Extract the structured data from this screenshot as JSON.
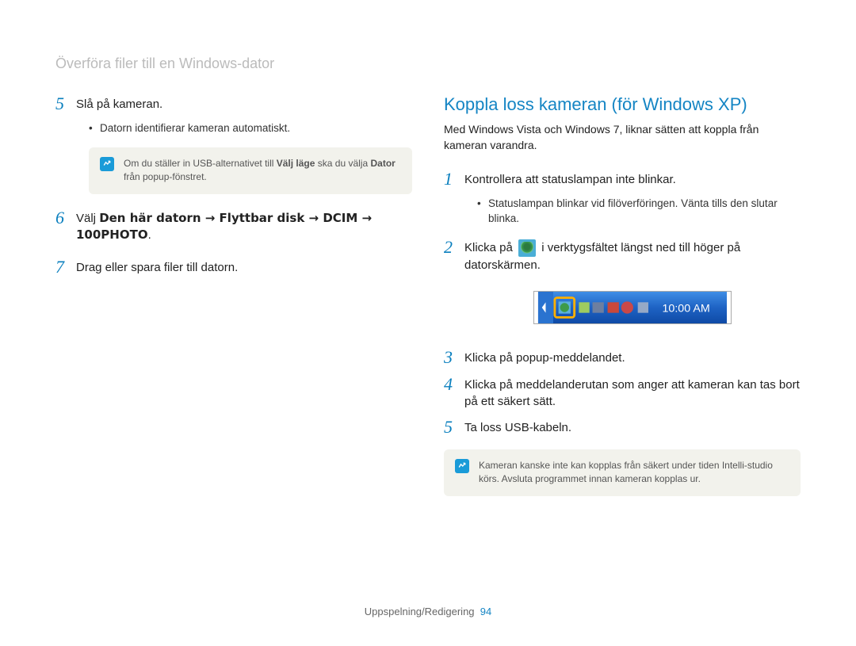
{
  "page_title": "Överföra ﬁler till en Windows-dator",
  "left": {
    "step5": {
      "num": "5",
      "text": "Slå på kameran.",
      "sub": "Datorn identiﬁerar kameran automatiskt."
    },
    "note1_prefix": "Om du ställer in USB-alternativet till ",
    "note1_bold1": "Välj läge",
    "note1_mid": " ska du välja ",
    "note1_bold2": "Dator",
    "note1_suffix": " från popup-fönstret.",
    "step6": {
      "num": "6",
      "prefix": "Välj ",
      "bold": "Den här datorn → Flyttbar disk → DCIM → 100PHOTO",
      "suffix": "."
    },
    "step7": {
      "num": "7",
      "text": "Drag eller spara ﬁler till datorn."
    }
  },
  "right": {
    "heading": "Koppla loss kameran (för Windows XP)",
    "intro": "Med Windows Vista och Windows 7, liknar sätten att koppla från kameran varandra.",
    "step1": {
      "num": "1",
      "text": "Kontrollera att statuslampan inte blinkar.",
      "sub": "Statuslampan blinkar vid ﬁlöverföringen. Vänta tills den slutar blinka."
    },
    "step2": {
      "num": "2",
      "prefix": "Klicka på ",
      "suffix": " i verktygsfältet längst ned till höger på datorskärmen."
    },
    "taskbar_time": "10:00 AM",
    "step3": {
      "num": "3",
      "text": "Klicka på popup-meddelandet."
    },
    "step4": {
      "num": "4",
      "text": "Klicka på meddelanderutan som anger att kameran kan tas bort på ett säkert sätt."
    },
    "step5": {
      "num": "5",
      "text": "Ta loss USB-kabeln."
    },
    "note2": "Kameran kanske inte kan kopplas från säkert under tiden Intelli-studio körs. Avsluta programmet innan kameran kopplas ur."
  },
  "footer": {
    "section": "Uppspelning/Redigering",
    "page": "94"
  }
}
